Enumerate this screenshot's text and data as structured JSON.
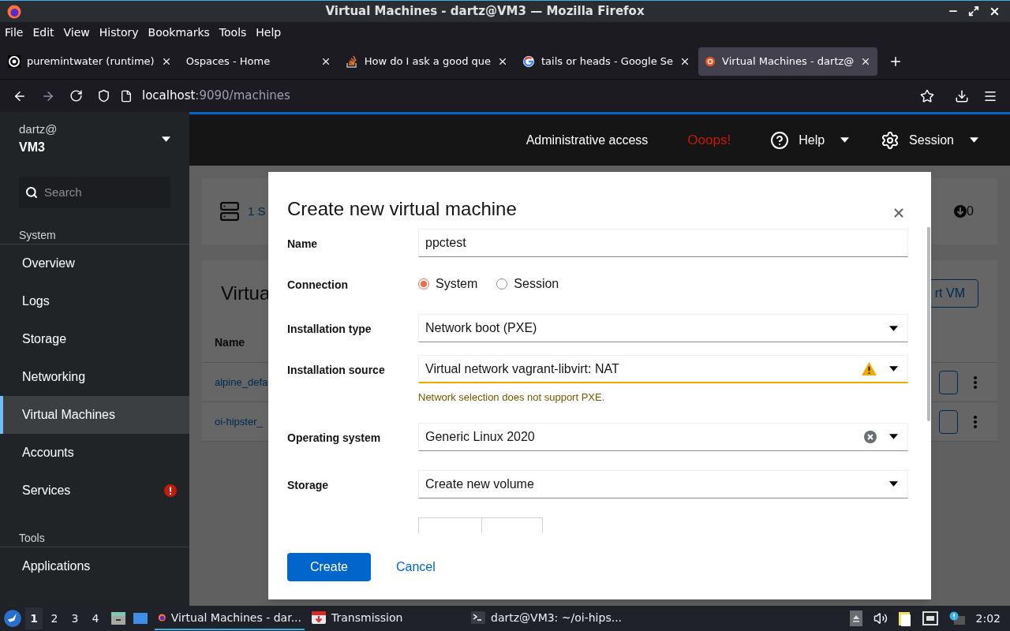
{
  "window": {
    "title": "Virtual Machines - dartz@VM3 — Mozilla Firefox"
  },
  "menu": [
    "File",
    "Edit",
    "View",
    "History",
    "Bookmarks",
    "Tools",
    "Help"
  ],
  "tabs": [
    {
      "label": "puremintwater (runtime)",
      "selected": false
    },
    {
      "label": "Ospaces - Home",
      "selected": false
    },
    {
      "label": "How do I ask a good que",
      "selected": false
    },
    {
      "label": "tails or heads - Google Se",
      "selected": false
    },
    {
      "label": "Virtual Machines - dartz@",
      "selected": true
    }
  ],
  "address": {
    "host": "localhost",
    "path": ":9090/machines"
  },
  "sidebar": {
    "user": "dartz@",
    "host": "VM3",
    "search": {
      "placeholder": "Search"
    },
    "sections": [
      {
        "title": "System",
        "items": [
          {
            "label": "Overview",
            "selected": false,
            "alert": false
          },
          {
            "label": "Logs",
            "selected": false,
            "alert": false
          },
          {
            "label": "Storage",
            "selected": false,
            "alert": false
          },
          {
            "label": "Networking",
            "selected": false,
            "alert": false
          },
          {
            "label": "Virtual Machines",
            "selected": true,
            "alert": false
          },
          {
            "label": "Accounts",
            "selected": false,
            "alert": false
          },
          {
            "label": "Services",
            "selected": false,
            "alert": true
          }
        ]
      },
      {
        "title": "Tools",
        "items": [
          {
            "label": "Applications",
            "selected": false,
            "alert": false
          }
        ]
      }
    ]
  },
  "header": {
    "access": "Administrative access",
    "error": "Ooops!",
    "help": "Help",
    "session": "Session"
  },
  "background": {
    "summary": "1 S",
    "count": "0",
    "heading": "Virtua",
    "action": "rt VM",
    "column": "Name",
    "rows": [
      "alpine_defa",
      "oi-hipster_"
    ]
  },
  "dialog": {
    "title": "Create new virtual machine",
    "fields": [
      {
        "kind": "text",
        "label": "Name",
        "value": "ppctest"
      },
      {
        "kind": "radio",
        "label": "Connection",
        "options": [
          {
            "label": "System",
            "selected": true
          },
          {
            "label": "Session",
            "selected": false
          }
        ]
      },
      {
        "kind": "select",
        "label": "Installation type",
        "value": "Network boot (PXE)",
        "warning": false,
        "clearable": false
      },
      {
        "kind": "select",
        "label": "Installation source",
        "value": "Virtual network vagrant-libvirt: NAT",
        "warning": true,
        "clearable": false,
        "helper": "Network selection does not support PXE."
      },
      {
        "kind": "select",
        "label": "Operating system",
        "value": "Generic Linux 2020",
        "warning": false,
        "clearable": true
      },
      {
        "kind": "select",
        "label": "Storage",
        "value": "Create new volume",
        "warning": false,
        "clearable": false
      }
    ],
    "buttons": [
      {
        "kind": "primary",
        "label": "Create"
      },
      {
        "kind": "link",
        "label": "Cancel"
      }
    ]
  },
  "taskbar": {
    "workspaces": [
      {
        "label": "1",
        "selected": true
      },
      {
        "label": "2",
        "selected": false
      },
      {
        "label": "3",
        "selected": false
      },
      {
        "label": "4",
        "selected": false
      }
    ],
    "windows": [
      {
        "label": "Virtual Machines - dar...",
        "selected": true
      },
      {
        "label": "Transmission",
        "selected": false
      },
      {
        "label": "dartz@VM3: ~/oi-hips...",
        "selected": false
      }
    ],
    "clock": "2:02"
  }
}
